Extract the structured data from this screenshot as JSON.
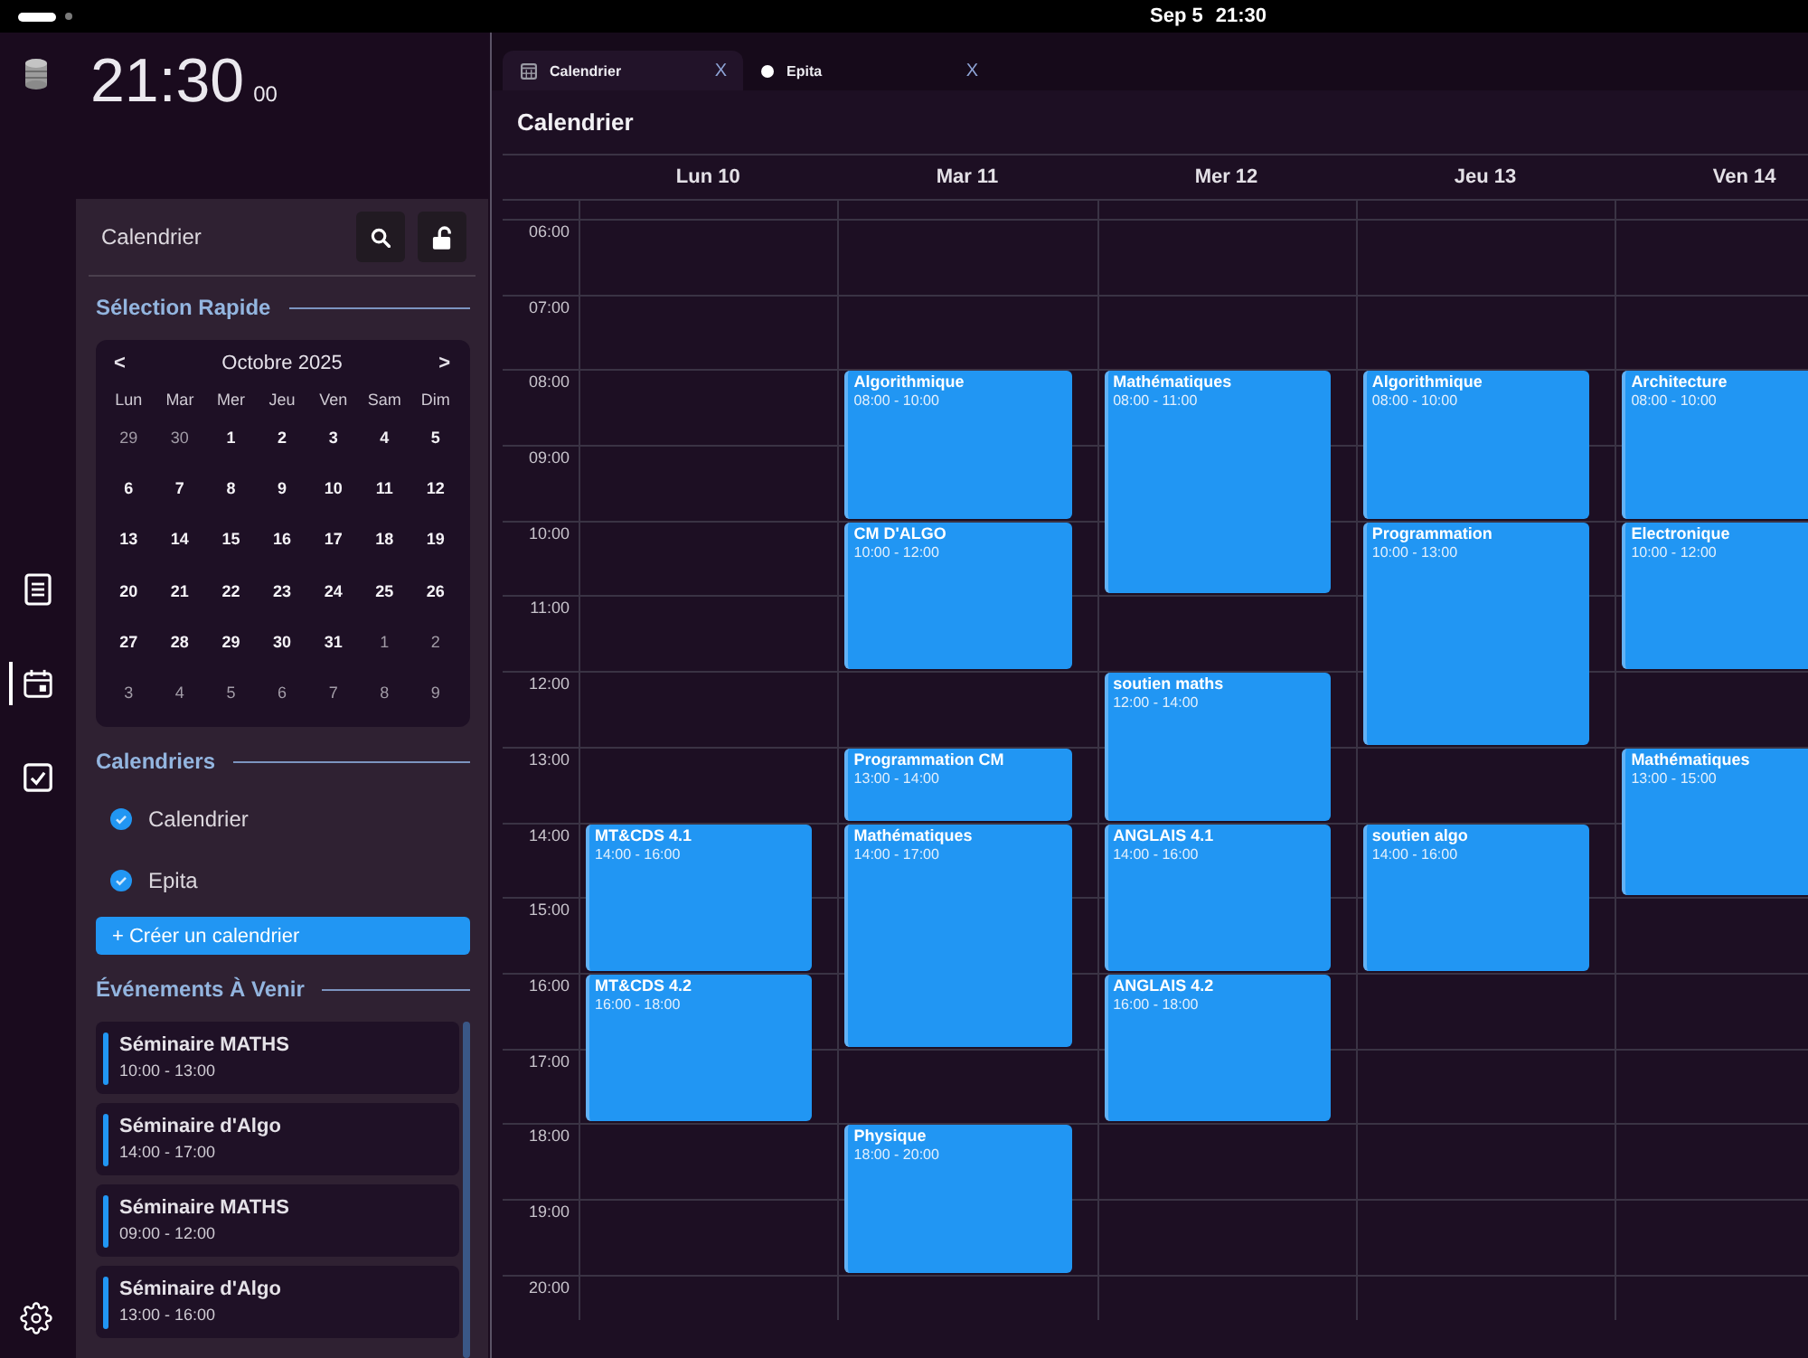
{
  "status_bar": {
    "date": "Sep 5",
    "time": "21:30"
  },
  "rail": {
    "items": [
      {
        "selected": false
      },
      {
        "selected": true
      },
      {
        "selected": false
      }
    ]
  },
  "clock": {
    "time": "21:30",
    "seconds": "00"
  },
  "sidebar": {
    "title": "Calendrier",
    "quick_select": {
      "heading": "Sélection Rapide",
      "prev": "<",
      "month": "Octobre 2025",
      "next": ">",
      "weekdays": [
        "Lun",
        "Mar",
        "Mer",
        "Jeu",
        "Ven",
        "Sam",
        "Dim"
      ],
      "weeks": [
        [
          {
            "day": "29",
            "in_month": false
          },
          {
            "day": "30",
            "in_month": false
          },
          {
            "day": "1",
            "in_month": true
          },
          {
            "day": "2",
            "in_month": true
          },
          {
            "day": "3",
            "in_month": true
          },
          {
            "day": "4",
            "in_month": true
          },
          {
            "day": "5",
            "in_month": true
          }
        ],
        [
          {
            "day": "6",
            "in_month": true
          },
          {
            "day": "7",
            "in_month": true
          },
          {
            "day": "8",
            "in_month": true
          },
          {
            "day": "9",
            "in_month": true
          },
          {
            "day": "10",
            "in_month": true
          },
          {
            "day": "11",
            "in_month": true
          },
          {
            "day": "12",
            "in_month": true
          }
        ],
        [
          {
            "day": "13",
            "in_month": true
          },
          {
            "day": "14",
            "in_month": true
          },
          {
            "day": "15",
            "in_month": true
          },
          {
            "day": "16",
            "in_month": true
          },
          {
            "day": "17",
            "in_month": true
          },
          {
            "day": "18",
            "in_month": true
          },
          {
            "day": "19",
            "in_month": true
          }
        ],
        [
          {
            "day": "20",
            "in_month": true
          },
          {
            "day": "21",
            "in_month": true
          },
          {
            "day": "22",
            "in_month": true
          },
          {
            "day": "23",
            "in_month": true
          },
          {
            "day": "24",
            "in_month": true
          },
          {
            "day": "25",
            "in_month": true
          },
          {
            "day": "26",
            "in_month": true
          }
        ],
        [
          {
            "day": "27",
            "in_month": true
          },
          {
            "day": "28",
            "in_month": true
          },
          {
            "day": "29",
            "in_month": true
          },
          {
            "day": "30",
            "in_month": true
          },
          {
            "day": "31",
            "in_month": true
          },
          {
            "day": "1",
            "in_month": false
          },
          {
            "day": "2",
            "in_month": false
          }
        ],
        [
          {
            "day": "3",
            "in_month": false
          },
          {
            "day": "4",
            "in_month": false
          },
          {
            "day": "5",
            "in_month": false
          },
          {
            "day": "6",
            "in_month": false
          },
          {
            "day": "7",
            "in_month": false
          },
          {
            "day": "8",
            "in_month": false
          },
          {
            "day": "9",
            "in_month": false
          }
        ]
      ]
    },
    "calendars": {
      "heading": "Calendriers",
      "items": [
        {
          "name": "Calendrier",
          "checked": true
        },
        {
          "name": "Epita",
          "checked": true
        }
      ],
      "create_button": "+ Créer un calendrier"
    },
    "upcoming": {
      "heading": "Événements À Venir",
      "events": [
        {
          "title": "Séminaire MATHS",
          "time": "10:00 - 13:00"
        },
        {
          "title": "Séminaire d'Algo",
          "time": "14:00 - 17:00"
        },
        {
          "title": "Séminaire MATHS",
          "time": "09:00 - 12:00"
        },
        {
          "title": "Séminaire d'Algo",
          "time": "13:00 - 16:00"
        }
      ]
    }
  },
  "tabs": [
    {
      "label": "Calendrier",
      "close": "X",
      "selected": true
    },
    {
      "label": "Epita",
      "close": "X",
      "selected": false
    }
  ],
  "calendar": {
    "title": "Calendrier",
    "hours": [
      "06:00",
      "07:00",
      "08:00",
      "09:00",
      "10:00",
      "11:00",
      "12:00",
      "13:00",
      "14:00",
      "15:00",
      "16:00",
      "17:00",
      "18:00",
      "19:00",
      "20:00"
    ],
    "days": [
      {
        "label": "Lun 10",
        "events": [
          {
            "title": "MT&CDS 4.1",
            "time": "14:00 - 16:00"
          },
          {
            "title": "MT&CDS 4.2",
            "time": "16:00 - 18:00"
          }
        ]
      },
      {
        "label": "Mar 11",
        "events": [
          {
            "title": "Algorithmique",
            "time": "08:00 - 10:00"
          },
          {
            "title": "CM D'ALGO",
            "time": "10:00 - 12:00"
          },
          {
            "title": "Programmation CM",
            "time": "13:00 - 14:00"
          },
          {
            "title": "Mathématiques",
            "time": "14:00 - 17:00"
          },
          {
            "title": "Physique",
            "time": "18:00 - 20:00"
          }
        ]
      },
      {
        "label": "Mer 12",
        "events": [
          {
            "title": "Mathématiques",
            "time": "08:00 - 11:00"
          },
          {
            "title": "soutien maths",
            "time": "12:00 - 14:00"
          },
          {
            "title": "ANGLAIS 4.1",
            "time": "14:00 - 16:00"
          },
          {
            "title": "ANGLAIS 4.2",
            "time": "16:00 - 18:00"
          }
        ]
      },
      {
        "label": "Jeu 13",
        "events": [
          {
            "title": "Algorithmique",
            "time": "08:00 - 10:00"
          },
          {
            "title": "Programmation",
            "time": "10:00 - 13:00"
          },
          {
            "title": "soutien algo",
            "time": "14:00 - 16:00"
          }
        ]
      },
      {
        "label": "Ven 14",
        "events": [
          {
            "title": "Architecture",
            "time": "08:00 - 10:00"
          },
          {
            "title": "Electronique",
            "time": "10:00 - 12:00"
          },
          {
            "title": "Mathématiques",
            "time": "13:00 - 15:00"
          }
        ]
      }
    ]
  }
}
